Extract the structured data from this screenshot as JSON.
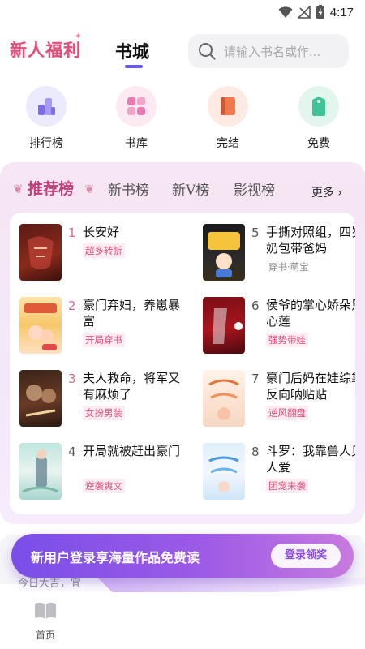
{
  "status": {
    "time": "4:17"
  },
  "header": {
    "welfare": "新人福利",
    "active_tab": "书城",
    "search_placeholder": "请输入书名或作..."
  },
  "quicknav": [
    {
      "label": "排行榜",
      "icon": "ranking-icon",
      "color": "#7d6cf2"
    },
    {
      "label": "书库",
      "icon": "library-icon",
      "color": "#e87ab0"
    },
    {
      "label": "完结",
      "icon": "book-complete-icon",
      "color": "#f07a4e"
    },
    {
      "label": "免费",
      "icon": "free-tag-icon",
      "color": "#3fc49a"
    }
  ],
  "rank": {
    "tabs": [
      "推荐榜",
      "新书榜",
      "新V榜",
      "影视榜"
    ],
    "more": "更多 ›",
    "books": [
      {
        "num": "1",
        "title": "长安好",
        "tag": "超多转折",
        "tag_style": "pink"
      },
      {
        "num": "2",
        "title": "豪门弃妇，养崽暴富",
        "tag": "开局穿书",
        "tag_style": "pink"
      },
      {
        "num": "3",
        "title": "夫人救命，将军又有麻烦了",
        "tag": "女扮男装",
        "tag_style": "pink"
      },
      {
        "num": "4",
        "title": "开局就被赶出豪门",
        "tag": "逆袭爽文",
        "tag_style": "pink"
      },
      {
        "num": "5",
        "title": "手撕对照组，四岁奶包带爸妈",
        "tag": "穿书·萌宝",
        "tag_style": "gray"
      },
      {
        "num": "6",
        "title": "侯爷的掌心娇朵黑心莲",
        "tag": "强势带娃",
        "tag_style": "pink"
      },
      {
        "num": "7",
        "title": "豪门后妈在娃综靠反向呐贴贴",
        "tag": "逆风翻盘",
        "tag_style": "pink"
      },
      {
        "num": "8",
        "title": "斗罗：我靠兽人见人爱",
        "tag": "团宠来袭",
        "tag_style": "pink"
      }
    ]
  },
  "feed_snippet": "今日大吉，宜",
  "promo": {
    "text": "新用户登录享海量作品免费读",
    "button": "登录领奖"
  },
  "bottom_nav": {
    "home": "首页"
  }
}
